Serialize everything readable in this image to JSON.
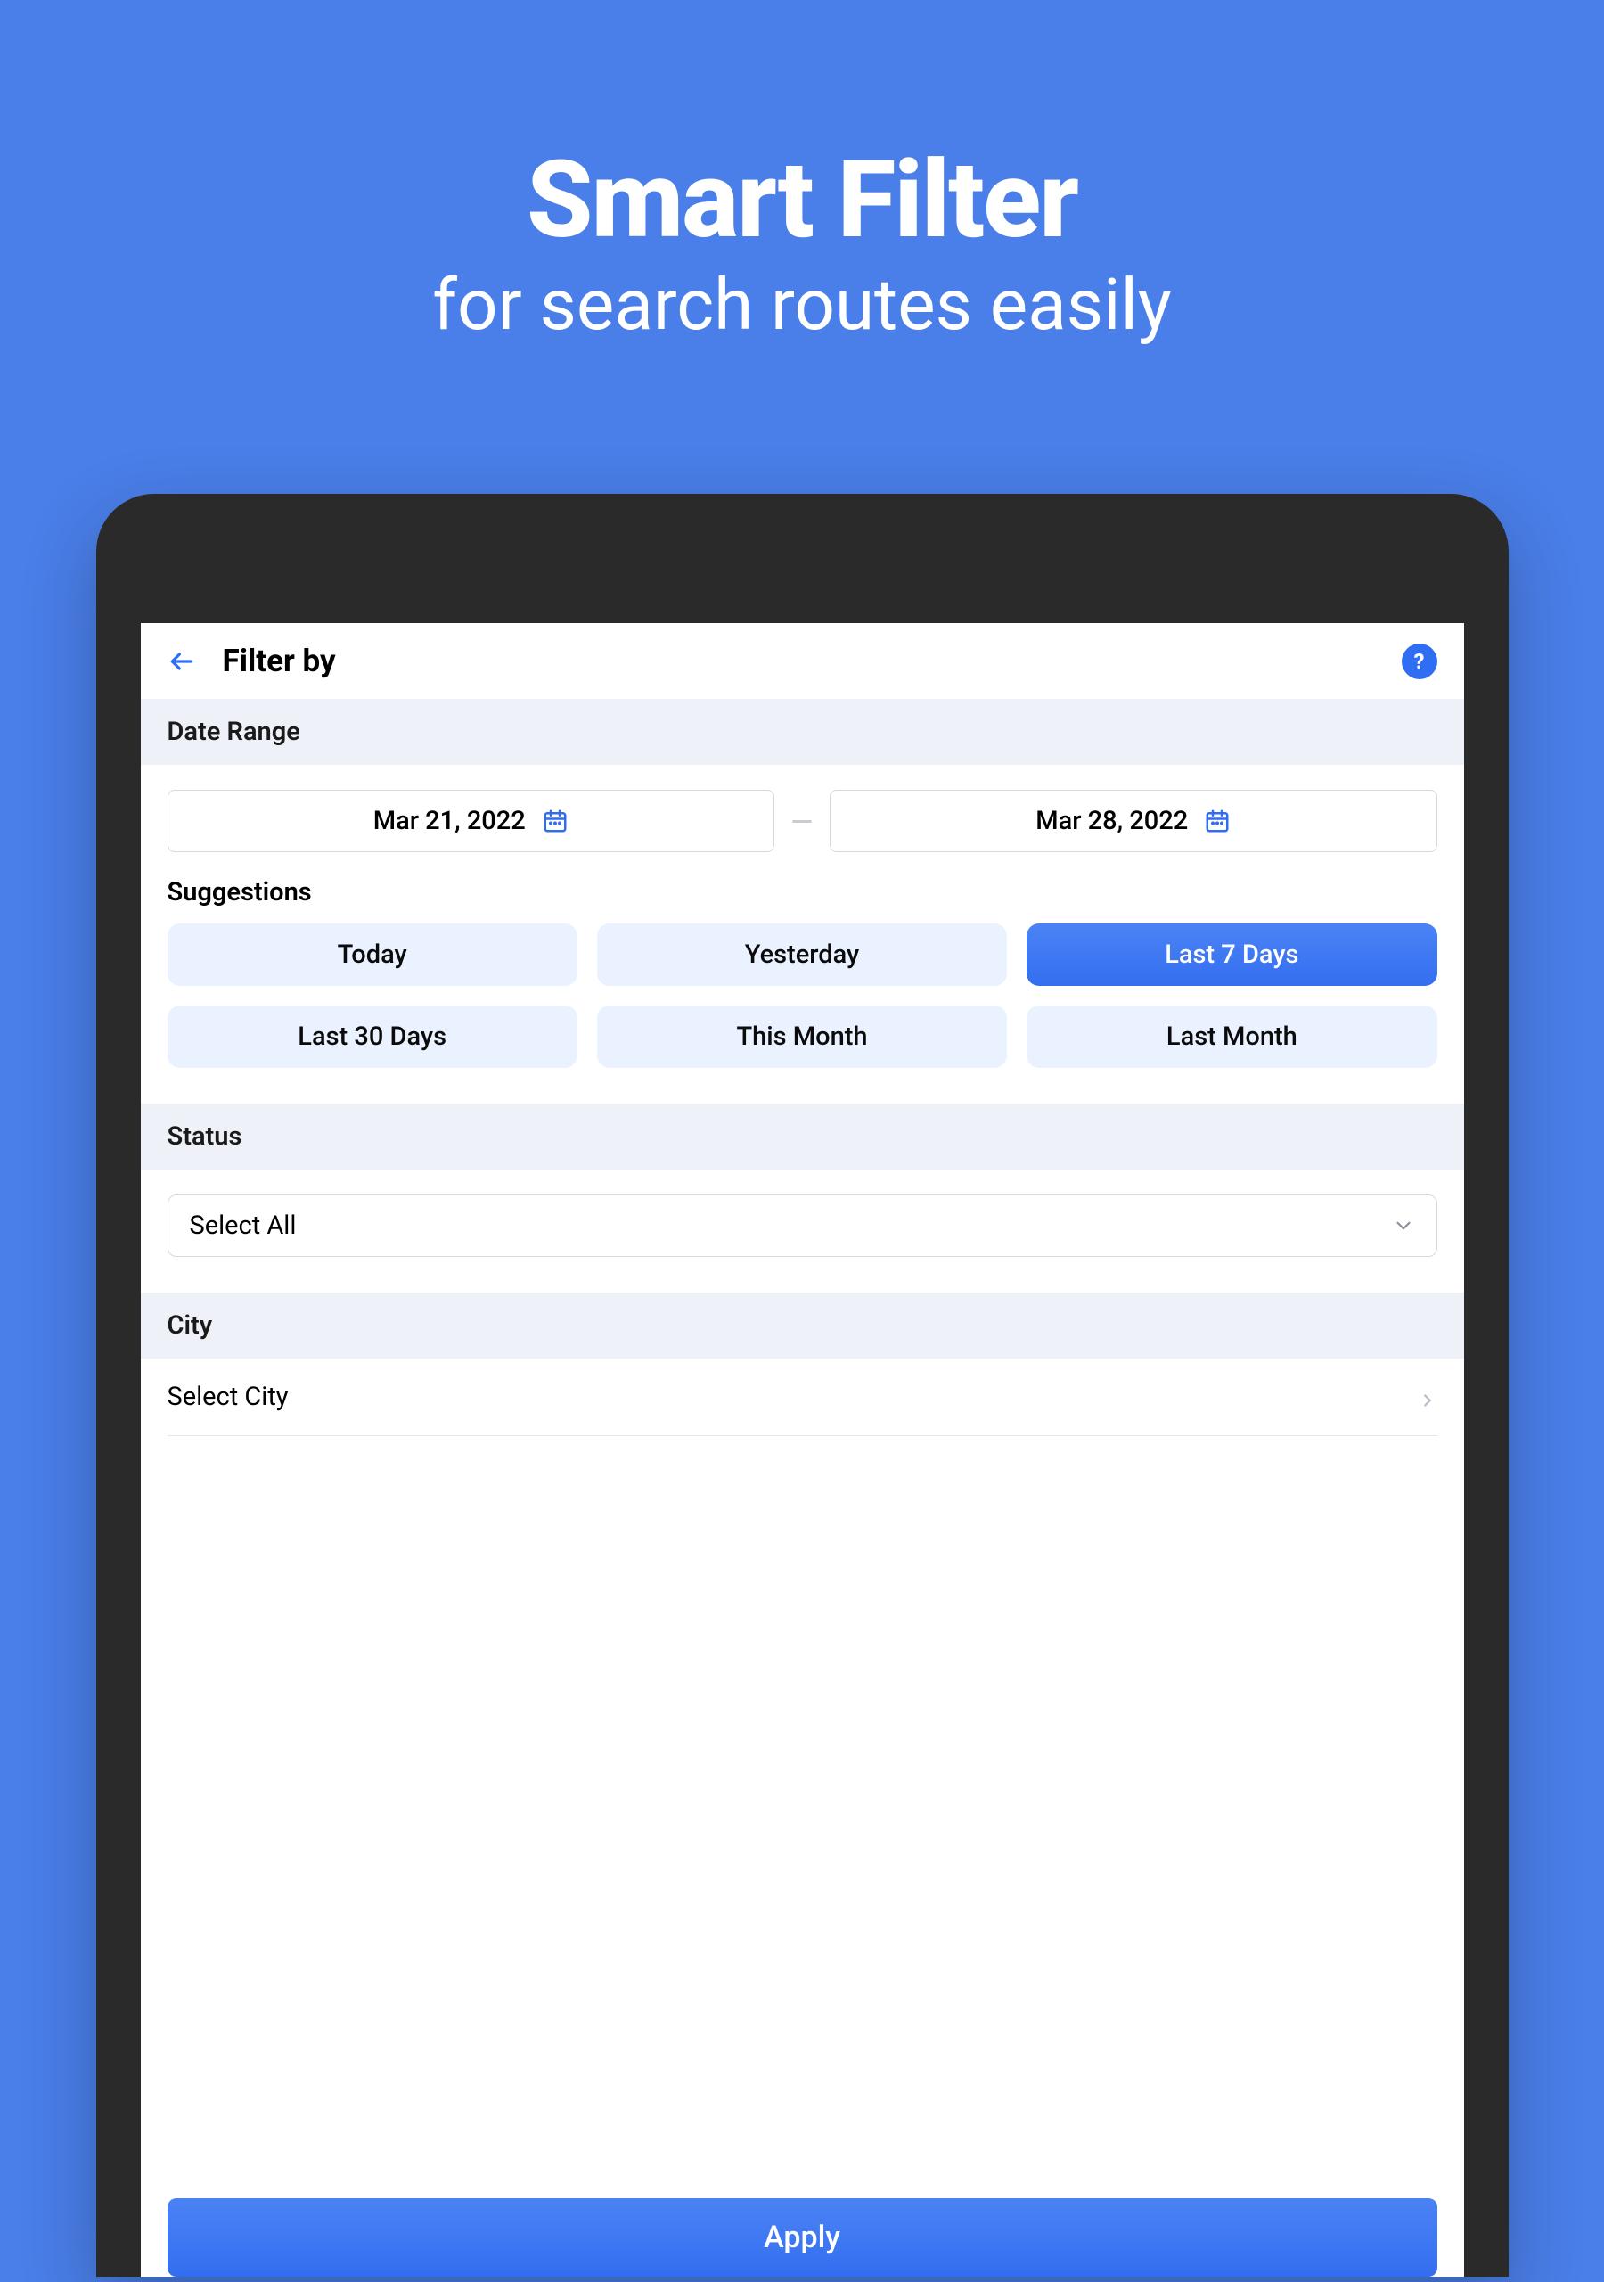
{
  "hero": {
    "title": "Smart Filter",
    "subtitle": "for search routes easily"
  },
  "toolbar": {
    "page_title": "Filter by",
    "help_symbol": "?"
  },
  "sections": {
    "date_range_label": "Date Range",
    "status_label": "Status",
    "city_label": "City"
  },
  "date": {
    "start": "Mar 21, 2022",
    "end": "Mar 28, 2022",
    "suggestions_label": "Suggestions",
    "chips": [
      {
        "label": "Today",
        "active": false
      },
      {
        "label": "Yesterday",
        "active": false
      },
      {
        "label": "Last 7 Days",
        "active": true
      },
      {
        "label": "Last 30 Days",
        "active": false
      },
      {
        "label": "This Month",
        "active": false
      },
      {
        "label": "Last Month",
        "active": false
      }
    ]
  },
  "status": {
    "selected": "Select All"
  },
  "city": {
    "placeholder": "Select City"
  },
  "actions": {
    "apply_label": "Apply"
  },
  "colors": {
    "bg": "#4a7ee8",
    "accent": "#336ef0",
    "chip_bg": "#e9f2fe",
    "section_bg": "#eef1f7"
  }
}
